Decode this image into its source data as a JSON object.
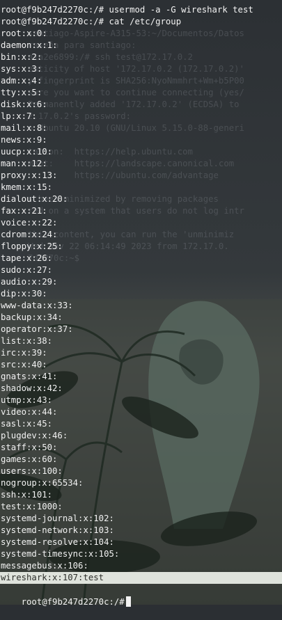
{
  "terminal": {
    "commands": [
      "root@f9b247d2270c:/# usermod -a -G wireshark test",
      "root@f9b247d2270c:/# cat /etc/group"
    ],
    "group_lines": [
      "root:x:0:",
      "daemon:x:1:",
      "bin:x:2:",
      "sys:x:3:",
      "adm:x:4:",
      "tty:x:5:",
      "disk:x:6:",
      "lp:x:7:",
      "mail:x:8:",
      "news:x:9:",
      "uucp:x:10:",
      "man:x:12:",
      "proxy:x:13:",
      "kmem:x:15:",
      "dialout:x:20:",
      "fax:x:21:",
      "voice:x:22:",
      "cdrom:x:24:",
      "floppy:x:25:",
      "tape:x:26:",
      "sudo:x:27:",
      "audio:x:29:",
      "dip:x:30:",
      "www-data:x:33:",
      "backup:x:34:",
      "operator:x:37:",
      "list:x:38:",
      "irc:x:39:",
      "src:x:40:",
      "gnats:x:41:",
      "shadow:x:42:",
      "utmp:x:43:",
      "video:x:44:",
      "sasl:x:45:",
      "plugdev:x:46:",
      "staff:x:50:",
      "games:x:60:",
      "users:x:100:",
      "nogroup:x:65534:",
      "ssh:x:101:",
      "test:x:1000:",
      "systemd-journal:x:102:",
      "systemd-network:x:103:",
      "systemd-resolve:x:104:",
      "systemd-timesync:x:105:",
      "messagebus:x:106:"
    ],
    "highlighted_line": "wireshark:x:107:test",
    "prompt": "root@f9b247d2270c:/#"
  },
  "background_terminal": {
    "lines": [
      "santiago-Aspire-A315-53:~/Documentos/Datos",
      "raseña para santiago:",
      "a1a2e6899:/# ssh test@172.17.0.2",
      "enticity of host '172.17.0.2 (172.17.0.2)'",
      "y fingerprint is SHA256:NyoNmmhrt+Wm+b5P00",
      "sure you want to continue connecting (yes/",
      "Permanently added '172.17.0.2' (ECDSA) to",
      "2.17.0.2's password:",
      "o Ubuntu 20.10 (GNU/Linux 5.15.0-88-generi",
      "",
      "tation:  https://help.ubuntu.com",
      "ment:    https://landscape.canonical.com",
      "         https://ubuntu.com/advantage",
      "",
      "s been minimized by removing packages",
      "red on a system that users do not log intr",
      "",
      "this content, you can run the 'unminimiz",
      "Wed Nov 22 06:14:49 2023 from 172.17.0.",
      "7d2270c:~$"
    ]
  }
}
